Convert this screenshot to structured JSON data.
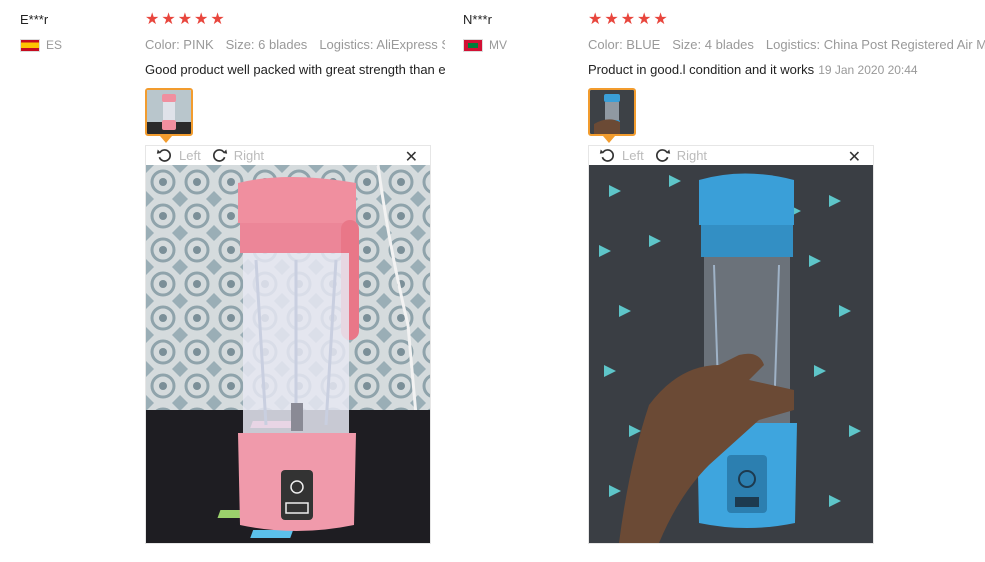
{
  "reviews": [
    {
      "user": "E***r",
      "country": "ES",
      "rating": 5,
      "attributes": {
        "color": "Color: PINK",
        "size": "Size: 6 blades",
        "logistics": "Logistics: AliExpress Standard Shipping"
      },
      "content": "Good product well packed with great strength than expected",
      "date": "",
      "viewer": {
        "left_label": "Left",
        "right_label": "Right",
        "close_glyph": "✕"
      },
      "colors": {
        "product": "#f08f9f",
        "star": "#e8463d"
      }
    },
    {
      "user": "N***r",
      "country": "MV",
      "rating": 5,
      "attributes": {
        "color": "Color: BLUE",
        "size": "Size: 4 blades",
        "logistics": "Logistics: China Post Registered Air Mail"
      },
      "content": "Product in good.l condition and it works",
      "date": "19 Jan 2020 20:44",
      "viewer": {
        "left_label": "Left",
        "right_label": "Right",
        "close_glyph": "✕"
      },
      "colors": {
        "product": "#3a9fd8",
        "star": "#e8463d"
      }
    }
  ]
}
